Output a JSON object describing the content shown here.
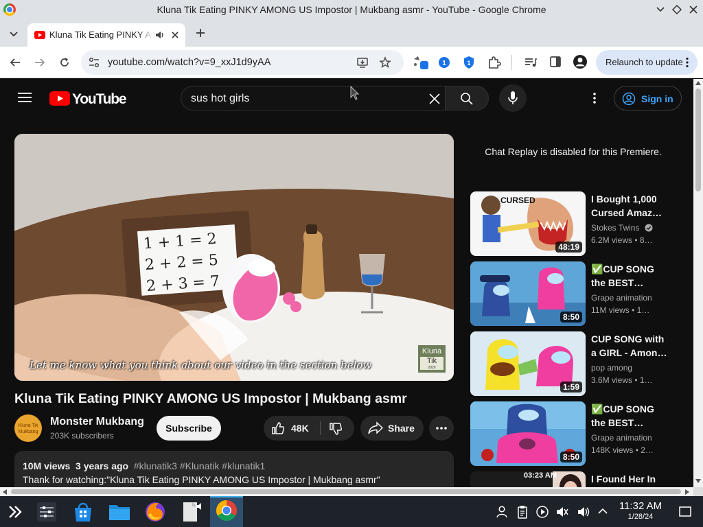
{
  "window": {
    "title": "Kluna Tik Eating PINKY AMONG US Impostor | Mukbang asmr - YouTube - Google Chrome"
  },
  "tab": {
    "title": "Kluna Tik Eating PINKY AMONG US Impostor | Mukbang asmr - YouTube"
  },
  "toolbar": {
    "url": "youtube.com/watch?v=9_xxJ1d9yAA",
    "relaunch_label": "Relaunch to update",
    "extension_badge": "1"
  },
  "youtube": {
    "logo_text": "YouTube",
    "search_value": "sus hot girls",
    "sign_in_label": "Sign in"
  },
  "video": {
    "whiteboard": [
      "1 + 1 = 2",
      "2 + 2 = 5",
      "2 + 3 = 7"
    ],
    "caption": "Let me know what you think about our video in the section below",
    "watermark_top": "Kluna",
    "watermark_bottom": "Tik",
    "watermark_small": "2020",
    "title": "Kluna Tik Eating PINKY AMONG US Impostor | Mukbang asmr",
    "channel_name": "Monster Mukbang",
    "channel_avatar_text": "Kluna Tik Mukbang",
    "subscribers": "203K subscribers",
    "subscribe_label": "Subscribe",
    "likes": "48K",
    "share_label": "Share",
    "views": "10M views",
    "age": "3 years ago",
    "hashtags": "#klunatik3 #Klunatik #klunatik1",
    "description": "Thank for watching:\"Kluna Tik Eating PINKY AMONG US Impostor | Mukbang asmr\""
  },
  "chat_replay": "Chat Replay is disabled for this Premiere.",
  "recommendations": [
    {
      "title_l1": "I Bought 1,000",
      "title_l2": "Cursed Amaz…",
      "channel": "Stokes Twins",
      "verified": true,
      "meta": "6.2M views  •  8…",
      "duration": "48:19",
      "thumb_text": "CURSED"
    },
    {
      "title_l1": "✅CUP SONG",
      "title_l2": "the BEST…",
      "channel": "Grape animation",
      "verified": false,
      "meta": "11M views  •  1…",
      "duration": "8:50"
    },
    {
      "title_l1": "CUP SONG with",
      "title_l2": "a GIRL - Amon…",
      "channel": "pop among",
      "verified": false,
      "meta": "3.6M views  •  1…",
      "duration": "1:59"
    },
    {
      "title_l1": "✅CUP SONG",
      "title_l2": "the BEST…",
      "channel": "Grape animation",
      "verified": false,
      "meta": "148K views  •  2…",
      "duration": "8:50"
    },
    {
      "title_l1": "I Found Her In",
      "title_l2": "",
      "channel": "",
      "verified": false,
      "meta": "",
      "duration": "",
      "thumb_text": "03:23 AM"
    }
  ],
  "taskbar": {
    "time": "11:32 AM",
    "date": "1/28/24"
  },
  "colors": {
    "youtube_red": "#ff0000",
    "link_blue": "#3ea6ff",
    "page_bg": "#0f0f0f",
    "chip_bg": "#272727"
  }
}
